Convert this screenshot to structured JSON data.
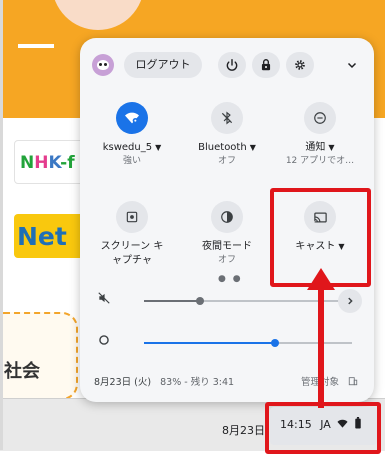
{
  "background": {
    "nhk_logo": "NHK",
    "net_banner": "Net",
    "subject": "社会"
  },
  "panel": {
    "header": {
      "avatar_icon": "penguin-avatar-icon",
      "logout_label": "ログアウト",
      "power_icon": "power-icon",
      "lock_icon": "lock-icon",
      "settings_icon": "gear-icon",
      "collapse_icon": "chevron-down-icon"
    },
    "tiles": [
      {
        "name": "wifi",
        "label": "kswedu_5",
        "sub": "強い",
        "icon": "wifi-icon",
        "on": true
      },
      {
        "name": "bluetooth",
        "label": "Bluetooth",
        "sub": "オフ",
        "icon": "bluetooth-off-icon",
        "on": false
      },
      {
        "name": "notifications",
        "label": "通知",
        "sub": "12 アプリでオ…",
        "icon": "do-not-disturb-icon",
        "on": false
      },
      {
        "name": "screen-capture",
        "label": "スクリーン キ",
        "label2": "ャプチャ",
        "icon": "screen-capture-icon",
        "on": false
      },
      {
        "name": "night-mode",
        "label": "夜間モード",
        "sub": "オフ",
        "icon": "night-light-icon",
        "on": false
      },
      {
        "name": "cast",
        "label": "キャスト",
        "icon": "cast-icon",
        "on": false
      }
    ],
    "page_dots": "● ●",
    "volume": {
      "icon": "volume-mute-icon",
      "level": 0.27,
      "next_icon": "chevron-right-icon"
    },
    "brightness": {
      "icon": "brightness-icon",
      "level": 0.63
    },
    "status": {
      "date": "8月23日 (火)",
      "battery": "83% - 残り 3:41",
      "managed": "管理対象",
      "managed_icon": "enterprise-building-icon"
    }
  },
  "shelf": {
    "date": "8月23日",
    "time": "14:15",
    "ime": "JA",
    "wifi_icon": "wifi-icon",
    "battery_icon": "battery-icon"
  },
  "annotations": {
    "color": "#e0161b",
    "highlights": [
      "cast-tile",
      "status-tray"
    ]
  },
  "colors": {
    "accent": "#1a73e8",
    "annotation": "#e0161b",
    "page_orange": "#f6a623"
  }
}
